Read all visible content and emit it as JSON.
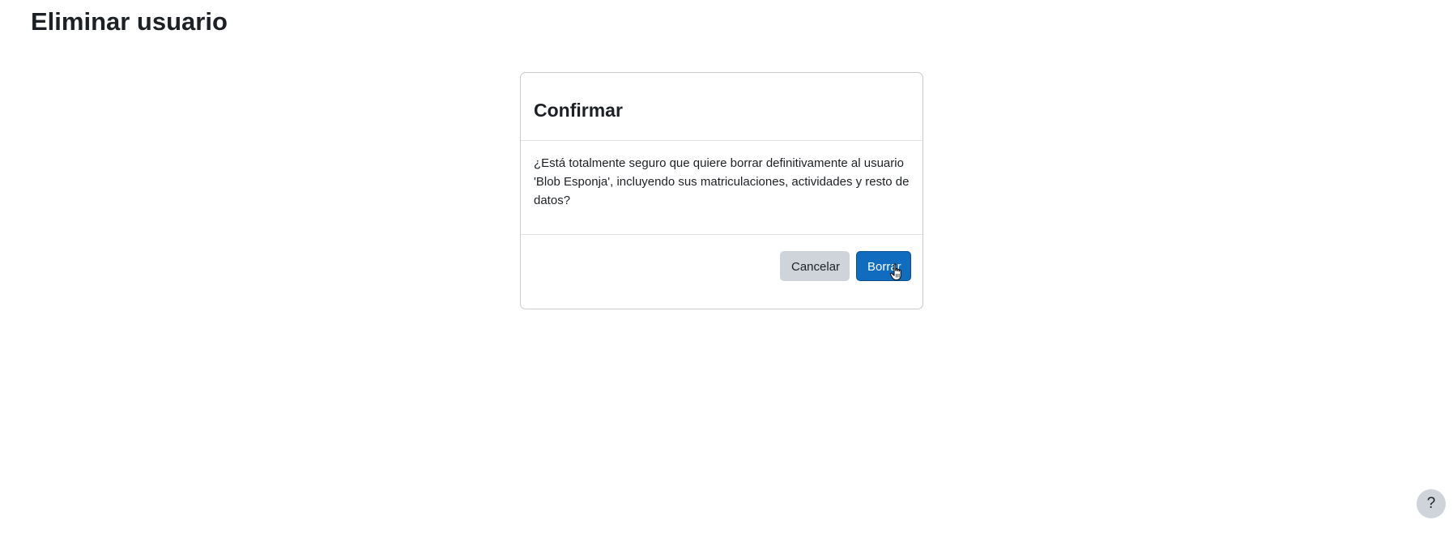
{
  "page": {
    "title": "Eliminar usuario"
  },
  "dialog": {
    "title": "Confirmar",
    "message": "¿Está totalmente seguro que quiere borrar definitivamente al usuario 'Blob Esponja', incluyendo sus matriculaciones, actividades y resto de datos?",
    "cancel_label": "Cancelar",
    "delete_label": "Borrar"
  },
  "help": {
    "label": "?",
    "icon": "question-mark-icon"
  },
  "cursor": {
    "icon": "hand-pointer-icon"
  },
  "colors": {
    "primary": "#0f6cbf",
    "secondary": "#ced4da",
    "text": "#1d2125"
  }
}
